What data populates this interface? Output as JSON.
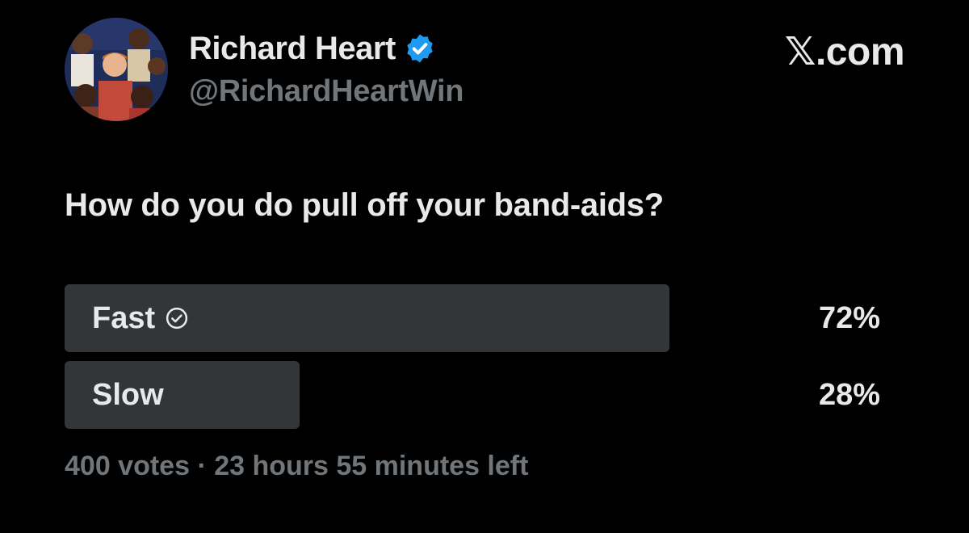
{
  "author": {
    "display_name": "Richard Heart",
    "handle": "@RichardHeartWin",
    "verified": true,
    "avatar_icon": "profile-photo"
  },
  "brand": "𝕏.com",
  "poll": {
    "question": "How do you do pull off your band-aids?",
    "options": [
      {
        "label": "Fast",
        "percent": "72%",
        "share": 0.72,
        "selected": true
      },
      {
        "label": "Slow",
        "percent": "28%",
        "share": 0.28,
        "selected": false
      }
    ],
    "meta": "400 votes · 23 hours 55 minutes left"
  },
  "colors": {
    "background": "#000000",
    "text_primary": "#e7e9ea",
    "text_secondary": "#71767b",
    "bar_fill": "#333639",
    "verified_blue": "#1d9bf0"
  }
}
